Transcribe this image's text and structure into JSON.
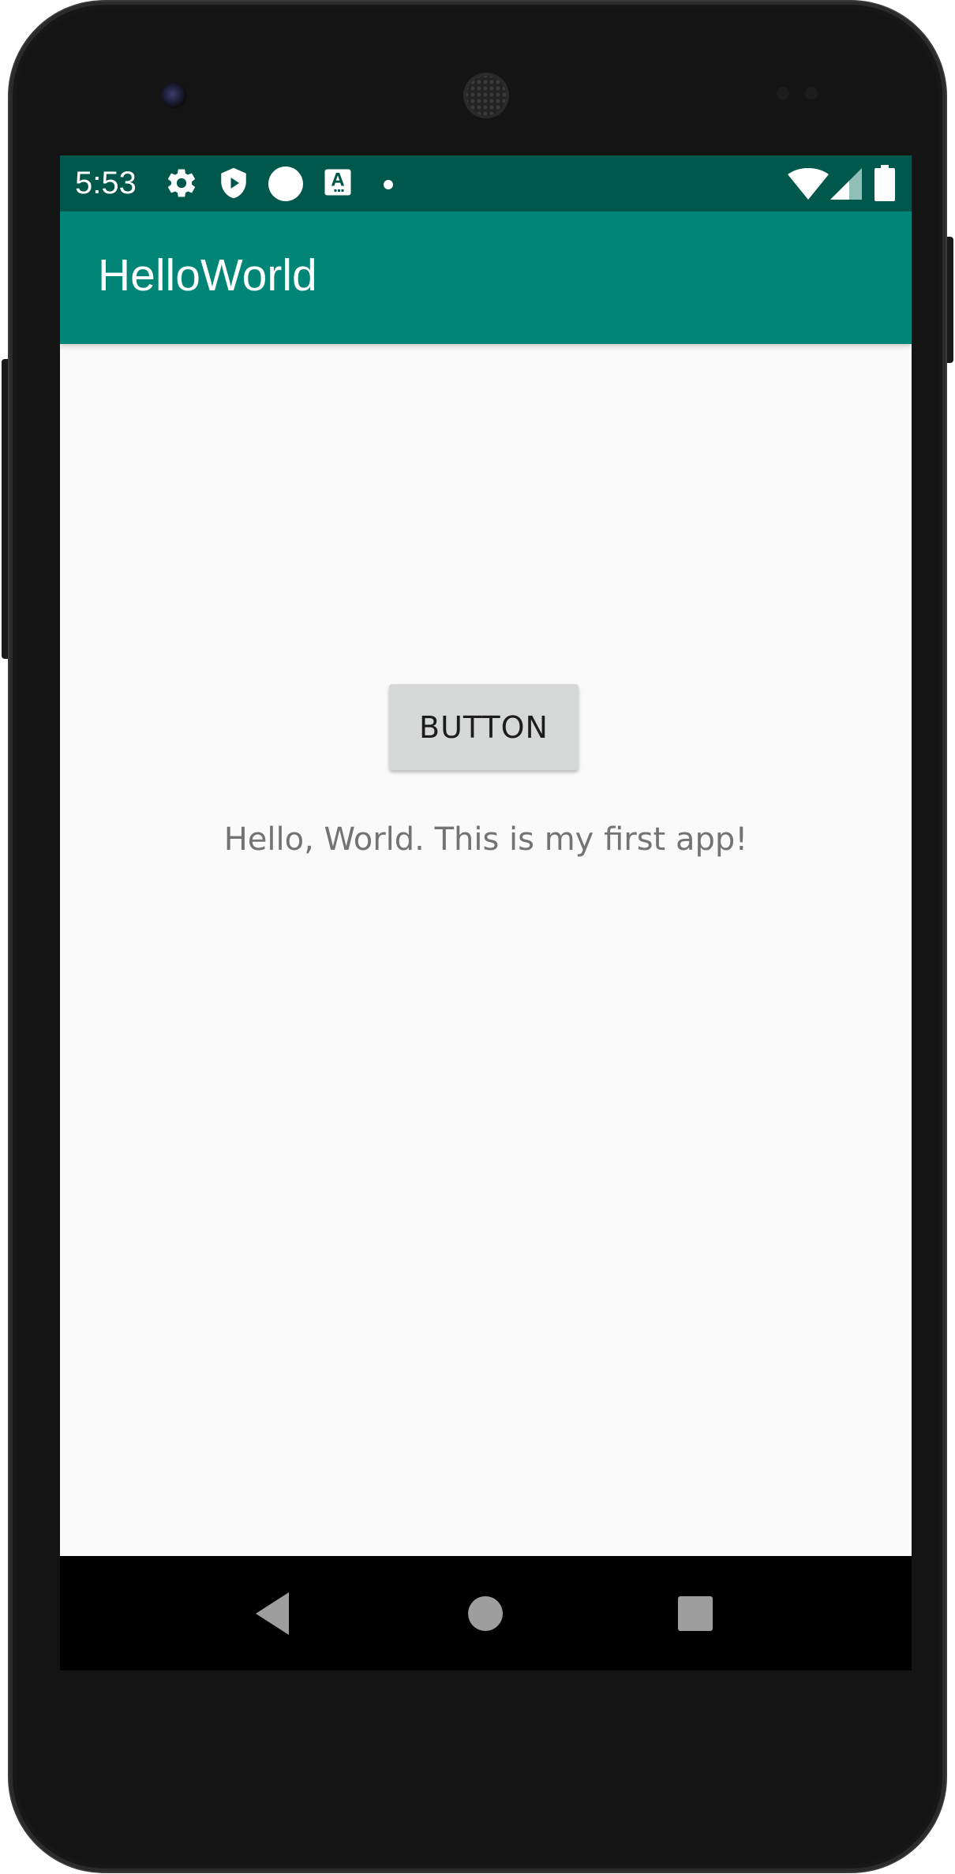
{
  "status_bar": {
    "time": "5:53",
    "icons": [
      "gear-icon",
      "shield-play-icon",
      "circle-icon",
      "text-a-icon",
      "dot-icon",
      "wifi-icon",
      "signal-icon",
      "battery-icon"
    ]
  },
  "app_bar": {
    "title": "HelloWorld"
  },
  "main": {
    "button_label": "BUTTON",
    "message": "Hello, World. This is my first app!"
  },
  "navigation": {
    "buttons": [
      "back-icon",
      "home-icon",
      "recents-icon"
    ]
  },
  "colors": {
    "status_bar": "#00574b",
    "app_bar": "#008577",
    "background": "#fafafa",
    "button": "#d6d7d7",
    "message_text": "#737373"
  }
}
